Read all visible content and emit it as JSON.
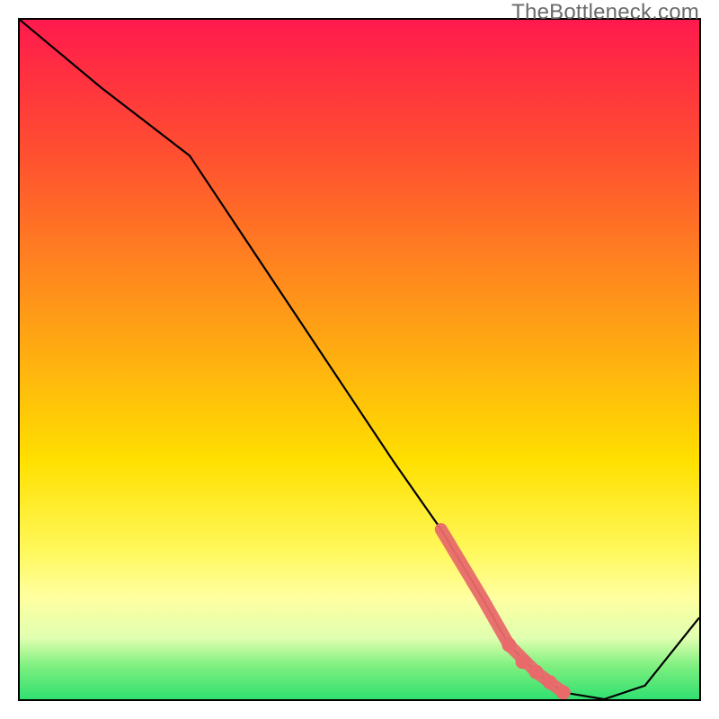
{
  "watermark": "TheBottleneck.com",
  "chart_data": {
    "type": "line",
    "title": "",
    "xlabel": "",
    "ylabel": "",
    "xlim": [
      0,
      100
    ],
    "ylim": [
      0,
      100
    ],
    "series": [
      {
        "name": "curve",
        "x": [
          0,
          12,
          25,
          35,
          45,
          55,
          62,
          68,
          72,
          76,
          80,
          86,
          92,
          100
        ],
        "values": [
          100,
          90,
          80,
          65,
          50,
          35,
          25,
          15,
          8,
          4,
          1,
          0,
          2,
          12
        ]
      }
    ],
    "highlight_segment": {
      "start_index": 6,
      "end_index": 10,
      "color": "#e86a6a"
    },
    "highlight_dots": {
      "x": [
        72,
        74,
        76,
        78,
        80
      ],
      "values": [
        8,
        5.5,
        4,
        2.5,
        1
      ],
      "color": "#e86a6a"
    },
    "background_gradient": {
      "top": "#ff1a4d",
      "mid": "#ffe000",
      "bottom": "#30e070"
    }
  }
}
